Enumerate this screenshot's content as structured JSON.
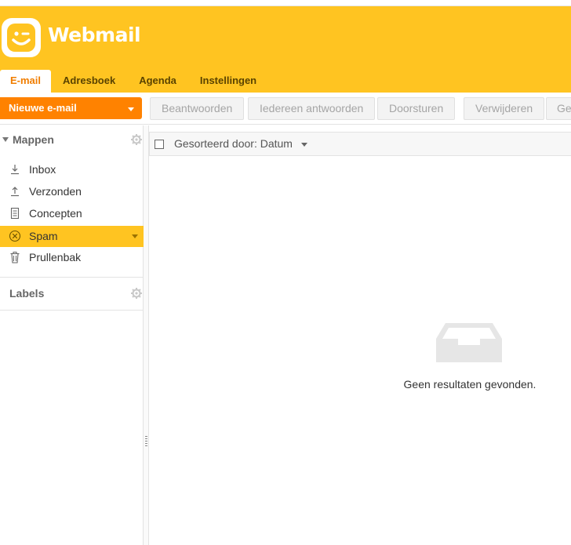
{
  "app": {
    "brand": "Webmail",
    "accent_color": "#ffc421",
    "action_color": "#ff8200",
    "logo_icon": "smiley-wink-icon"
  },
  "tabs": [
    {
      "label": "E-mail",
      "active": true
    },
    {
      "label": "Adresboek",
      "active": false
    },
    {
      "label": "Agenda",
      "active": false
    },
    {
      "label": "Instellingen",
      "active": false
    }
  ],
  "toolbar": {
    "new_mail_label": "Nieuwe e-mail",
    "buttons": [
      {
        "label": "Beantwoorden",
        "enabled": false
      },
      {
        "label": "Iedereen antwoorden",
        "enabled": false
      },
      {
        "label": "Doorsturen",
        "enabled": false
      },
      {
        "label": "Verwijderen",
        "enabled": false
      },
      {
        "label": "Ge",
        "enabled": false
      }
    ]
  },
  "sidebar": {
    "folders_heading": "Mappen",
    "folders": [
      {
        "label": "Inbox",
        "icon": "inbox-arrow-icon",
        "active": false
      },
      {
        "label": "Verzonden",
        "icon": "sent-arrow-icon",
        "active": false
      },
      {
        "label": "Concepten",
        "icon": "draft-document-icon",
        "active": false
      },
      {
        "label": "Spam",
        "icon": "spam-circle-x-icon",
        "active": true
      },
      {
        "label": "Prullenbak",
        "icon": "trash-icon",
        "active": false
      }
    ],
    "labels_heading": "Labels"
  },
  "message_list": {
    "sort_label": "Gesorteerd door: Datum",
    "empty_icon": "empty-tray-icon",
    "empty_text": "Geen resultaten gevonden."
  }
}
